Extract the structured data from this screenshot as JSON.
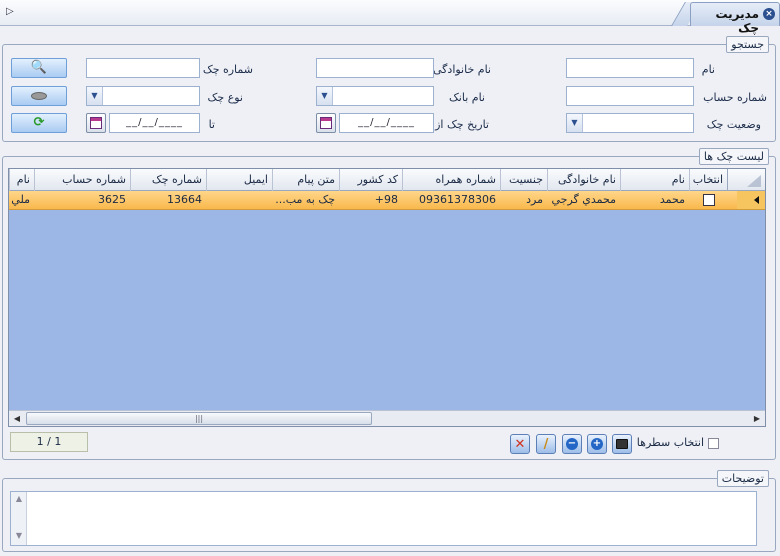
{
  "window": {
    "title": "مدیریت چک"
  },
  "search": {
    "legend": "جستجو",
    "labels": {
      "first_name": "نام",
      "last_name": "نام خانوادگی",
      "check_number": "شماره چک",
      "account_number": "شماره حساب",
      "bank_name": "نام بانک",
      "check_type": "نوع چک",
      "check_status": "وضعیت چک",
      "check_date_from": "تاریخ چک از",
      "to": "تا"
    },
    "values": {
      "first_name": "",
      "last_name": "",
      "check_number": "",
      "account_number": "",
      "bank_name": "",
      "check_type": "",
      "check_status": ""
    },
    "date_placeholder": "__/__/____"
  },
  "list": {
    "legend": "لیست چک ها",
    "columns": [
      "انتخاب",
      "نام",
      "نام خانوادگی",
      "جنسیت",
      "شماره همراه",
      "کد کشور",
      "متن پیام",
      "ایمیل",
      "شماره چک",
      "شماره حساب",
      "نام"
    ],
    "rows": [
      {
        "selected": false,
        "first_name": "محمد",
        "last_name": "محمدي گرجي",
        "gender": "مرد",
        "mobile": "09361378306",
        "country_code": "+98",
        "message": "چک به مب...",
        "email": "",
        "check_number": "13664",
        "account_number": "3625",
        "bank_name": "ملي"
      }
    ],
    "pager": "1 / 1",
    "select_rows_label": "انتخاب سطرها"
  },
  "notes": {
    "legend": "توضیحات",
    "value": ""
  },
  "colors": {
    "accent": "#2c4f8f",
    "grid_background": "#9cb6e6",
    "selected_row": "#f9b84c"
  }
}
